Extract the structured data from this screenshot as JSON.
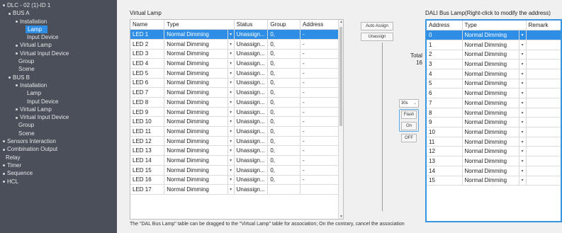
{
  "tree": [
    {
      "label": "DLC - 02 (1)-ID 1",
      "indent": 4,
      "bullet": true,
      "selected": false
    },
    {
      "label": "BUS A",
      "indent": 12,
      "bullet": true,
      "selected": false
    },
    {
      "label": "Installation",
      "indent": 22,
      "bullet": true,
      "selected": false
    },
    {
      "label": "Lamp",
      "indent": 36,
      "bullet": false,
      "selected": true
    },
    {
      "label": "Input Device",
      "indent": 38,
      "bullet": false,
      "selected": false
    },
    {
      "label": "Virtual Lamp",
      "indent": 22,
      "bullet": true,
      "selected": false
    },
    {
      "label": "Virtual Input Device",
      "indent": 22,
      "bullet": true,
      "selected": false
    },
    {
      "label": "Group",
      "indent": 26,
      "bullet": false,
      "selected": false
    },
    {
      "label": "Scene",
      "indent": 26,
      "bullet": false,
      "selected": false
    },
    {
      "label": "BUS B",
      "indent": 12,
      "bullet": true,
      "selected": false
    },
    {
      "label": "Installation",
      "indent": 22,
      "bullet": true,
      "selected": false
    },
    {
      "label": "Lamp",
      "indent": 38,
      "bullet": false,
      "selected": false
    },
    {
      "label": "Input Device",
      "indent": 38,
      "bullet": false,
      "selected": false
    },
    {
      "label": "Virtual Lamp",
      "indent": 22,
      "bullet": true,
      "selected": false
    },
    {
      "label": "Virtual Input Device",
      "indent": 22,
      "bullet": true,
      "selected": false
    },
    {
      "label": "Group",
      "indent": 26,
      "bullet": false,
      "selected": false
    },
    {
      "label": "Scene",
      "indent": 26,
      "bullet": false,
      "selected": false
    },
    {
      "label": "Sensors Interaction",
      "indent": 4,
      "bullet": true,
      "selected": false
    },
    {
      "label": "Combination Output",
      "indent": 4,
      "bullet": true,
      "selected": false
    },
    {
      "label": "Relay",
      "indent": 8,
      "bullet": false,
      "selected": false
    },
    {
      "label": "Timer",
      "indent": 4,
      "bullet": true,
      "selected": false
    },
    {
      "label": "Sequence",
      "indent": 4,
      "bullet": true,
      "selected": false
    },
    {
      "label": "HCL",
      "indent": 4,
      "bullet": true,
      "selected": false
    }
  ],
  "virtual_lamp": {
    "title": "Virtual Lamp",
    "columns": [
      "Name",
      "Type",
      "Status",
      "Group",
      "Address"
    ],
    "rows": [
      [
        "LED 1",
        "Normal Dimming",
        "Unassign...",
        "0,",
        "-"
      ],
      [
        "LED 2",
        "Normal Dimming",
        "Unassign...",
        "0,",
        "-"
      ],
      [
        "LED 3",
        "Normal Dimming",
        "Unassign...",
        "0,",
        "-"
      ],
      [
        "LED 4",
        "Normal Dimming",
        "Unassign...",
        "0,",
        "-"
      ],
      [
        "LED 5",
        "Normal Dimming",
        "Unassign...",
        "0,",
        "-"
      ],
      [
        "LED 6",
        "Normal Dimming",
        "Unassign...",
        "0,",
        "-"
      ],
      [
        "LED 7",
        "Normal Dimming",
        "Unassign...",
        "0,",
        "-"
      ],
      [
        "LED 8",
        "Normal Dimming",
        "Unassign...",
        "0,",
        "-"
      ],
      [
        "LED 9",
        "Normal Dimming",
        "Unassign...",
        "0,",
        "-"
      ],
      [
        "LED 10",
        "Normal Dimming",
        "Unassign...",
        "0,",
        "-"
      ],
      [
        "LED 11",
        "Normal Dimming",
        "Unassign...",
        "0,",
        "-"
      ],
      [
        "LED 12",
        "Normal Dimming",
        "Unassign...",
        "0,",
        "-"
      ],
      [
        "LED 13",
        "Normal Dimming",
        "Unassign...",
        "0,",
        "-"
      ],
      [
        "LED 14",
        "Normal Dimming",
        "Unassign...",
        "0,",
        "-"
      ],
      [
        "LED 15",
        "Normal Dimming",
        "Unassign...",
        "0,",
        "-"
      ],
      [
        "LED 16",
        "Normal Dimming",
        "Unassign...",
        "0,",
        "-"
      ],
      [
        "LED 17",
        "Normal Dimming",
        "Unassign...",
        "",
        ""
      ]
    ],
    "selected_row": 0
  },
  "controls": {
    "auto_assign": "Auto Assign",
    "unassign": "Unassign",
    "total_label": "Total",
    "total_value": "16",
    "speed_value": "30s",
    "flash": "Flash",
    "on": "On",
    "off": "OFF"
  },
  "dali_bus": {
    "title": "DALI Bus Lamp(Right-click to modify the address)",
    "columns": [
      "Address",
      "Type",
      "Remark"
    ],
    "rows": [
      [
        "0",
        "Normal Dimming",
        ""
      ],
      [
        "1",
        "Normal Dimming",
        ""
      ],
      [
        "2",
        "Normal Dimming",
        ""
      ],
      [
        "3",
        "Normal Dimming",
        ""
      ],
      [
        "4",
        "Normal Dimming",
        ""
      ],
      [
        "5",
        "Normal Dimming",
        ""
      ],
      [
        "6",
        "Normal Dimming",
        ""
      ],
      [
        "7",
        "Normal Dimming",
        ""
      ],
      [
        "8",
        "Normal Dimming",
        ""
      ],
      [
        "9",
        "Normal Dimming",
        ""
      ],
      [
        "10",
        "Normal Dimming",
        ""
      ],
      [
        "11",
        "Normal Dimming",
        ""
      ],
      [
        "12",
        "Normal Dimming",
        ""
      ],
      [
        "13",
        "Normal Dimming",
        ""
      ],
      [
        "14",
        "Normal Dimming",
        ""
      ],
      [
        "15",
        "Normal Dimming",
        ""
      ]
    ],
    "selected_row": 0
  },
  "footer_note": "The \"DAL Bus Lamp\" table can be dragged to the \"Virtual Lamp\" table for association;  On the contrary, cancel the association",
  "icons": {
    "dropdown": "chevron-down-icon",
    "scroll_up": "scroll-up-icon",
    "scroll_down": "scroll-down-icon"
  },
  "colors": {
    "selection": "#2e8ee6",
    "tree_bg": "#4a4f5a",
    "dali_border": "#3a95e0"
  }
}
